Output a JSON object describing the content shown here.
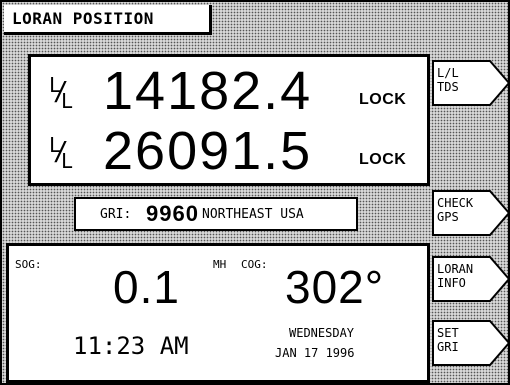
{
  "header": {
    "title": "LORAN POSITION"
  },
  "loran": {
    "line1": {
      "value": "14182.4",
      "status": "LOCK"
    },
    "line2": {
      "value": "26091.5",
      "status": "LOCK"
    }
  },
  "gri": {
    "label": "GRI:",
    "value": "9960",
    "region": "NORTHEAST USA"
  },
  "navigation": {
    "sog_label": "SOG:",
    "sog_value": "0.1",
    "sog_unit": "MH",
    "cog_label": "COG:",
    "cog_value": "302°",
    "time": "11:23 AM",
    "day": "WEDNESDAY",
    "date": "JAN 17 1996"
  },
  "softkeys": [
    {
      "label": "L/L\nTDS"
    },
    {
      "label": "CHECK\nGPS"
    },
    {
      "label": "LORAN\nINFO"
    },
    {
      "label": "SET\nGRI"
    }
  ],
  "icons": {
    "lop_icon": "lop-fraction-icon"
  },
  "colors": {
    "background": "#d6d6d6",
    "panel": "#ffffff",
    "ink": "#000000"
  }
}
